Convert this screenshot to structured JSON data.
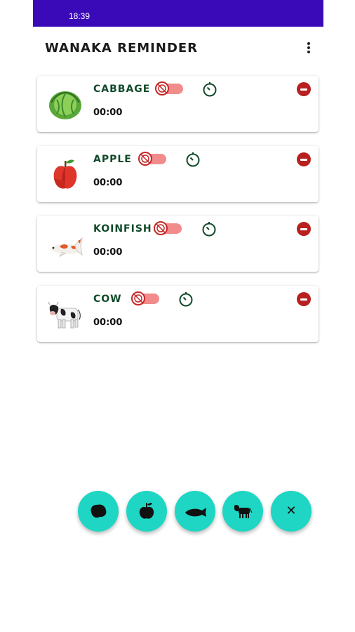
{
  "status": {
    "time": "18:39"
  },
  "app": {
    "title": "WANAKA REMINDER"
  },
  "reminders": [
    {
      "name": "CABBAGE",
      "time": "00:00",
      "icon": "cabbage-icon"
    },
    {
      "name": "APPLE",
      "time": "00:00",
      "icon": "apple-icon"
    },
    {
      "name": "KOINFISH",
      "time": "00:00",
      "icon": "koi-fish-icon"
    },
    {
      "name": "COW",
      "time": "00:00",
      "icon": "cow-icon"
    }
  ],
  "fab": {
    "items": [
      "cabbage-icon",
      "apple-icon",
      "koi-fish-icon",
      "cow-icon"
    ],
    "close_label": "✕"
  },
  "colors": {
    "status_bar": "#3a0ab8",
    "fab": "#1ed6c3",
    "remove": "#b82020",
    "toggle_track": "#f28b8b",
    "name_text": "#114a2a"
  }
}
